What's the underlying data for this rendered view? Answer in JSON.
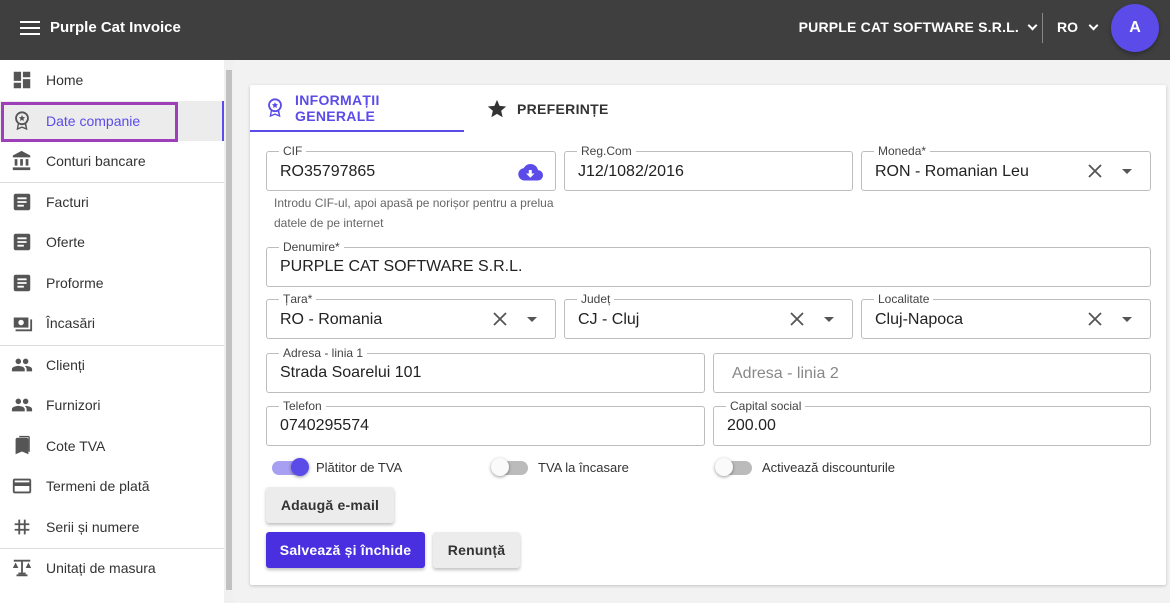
{
  "app": {
    "title": "Purple Cat Invoice"
  },
  "header": {
    "company": "PURPLE CAT SOFTWARE S.R.L.",
    "language": "RO",
    "avatar_initial": "A"
  },
  "sidebar": {
    "items": [
      {
        "label": "Home",
        "icon": "dashboard-icon"
      },
      {
        "label": "Date companie",
        "icon": "award-icon",
        "active": true
      },
      {
        "label": "Conturi bancare",
        "icon": "bank-icon"
      },
      {
        "label": "Facturi",
        "icon": "document-icon"
      },
      {
        "label": "Oferte",
        "icon": "document-icon"
      },
      {
        "label": "Proforme",
        "icon": "document-icon"
      },
      {
        "label": "Încasări",
        "icon": "cash-icon"
      },
      {
        "label": "Clienți",
        "icon": "people-icon"
      },
      {
        "label": "Furnizori",
        "icon": "people-icon"
      },
      {
        "label": "Cote TVA",
        "icon": "bookmark-icon"
      },
      {
        "label": "Termeni de plată",
        "icon": "credit-card-icon"
      },
      {
        "label": "Serii și numere",
        "icon": "hash-icon"
      },
      {
        "label": "Unitați de masura",
        "icon": "scale-icon"
      }
    ]
  },
  "tabs": [
    {
      "label": "INFORMAȚII GENERALE",
      "active": true
    },
    {
      "label": "PREFERINȚE"
    }
  ],
  "form": {
    "cif": {
      "label": "CIF",
      "value": "RO35797865"
    },
    "cif_hint": "Introdu CIF-ul, apoi apasă pe norișor pentru a prelua datele de pe internet",
    "regcom": {
      "label": "Reg.Com",
      "value": "J12/1082/2016"
    },
    "moneda": {
      "label": "Moneda*",
      "value": "RON - Romanian Leu"
    },
    "denumire": {
      "label": "Denumire*",
      "value": "PURPLE CAT SOFTWARE S.R.L."
    },
    "tara": {
      "label": "Țara*",
      "value": "RO - Romania"
    },
    "judet": {
      "label": "Județ",
      "value": "CJ - Cluj"
    },
    "localitate": {
      "label": "Localitate",
      "value": "Cluj-Napoca"
    },
    "adresa1": {
      "label": "Adresa - linia 1",
      "value": "Strada Soarelui 101"
    },
    "adresa2": {
      "placeholder": "Adresa - linia 2"
    },
    "telefon": {
      "label": "Telefon",
      "value": "0740295574"
    },
    "capital": {
      "label": "Capital social",
      "value": "200.00"
    },
    "toggles": [
      {
        "label": "Plătitor de TVA",
        "on": true
      },
      {
        "label": "TVA la încasare",
        "on": false
      },
      {
        "label": "Activează discounturile",
        "on": false
      }
    ]
  },
  "buttons": {
    "add_email": "Adaugă e-mail",
    "save": "Salvează și închide",
    "cancel": "Renunță"
  },
  "colors": {
    "accent": "#5b4be8",
    "topbar": "#3f3f3f",
    "primary_button": "#4a2fe0",
    "highlight": "#9c3fb8"
  }
}
